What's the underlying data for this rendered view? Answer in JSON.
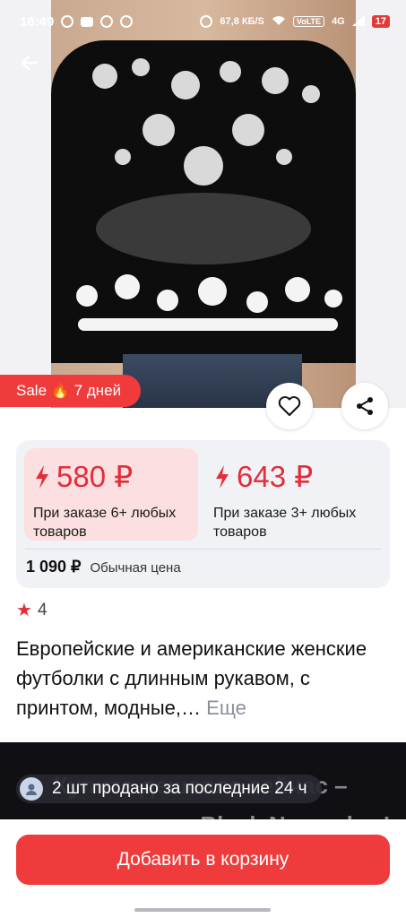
{
  "statusbar": {
    "time": "18:49",
    "speed": "67,8 КБ/S",
    "volte": "VoLTE",
    "net": "4G",
    "battery": "17"
  },
  "sale_badge": {
    "text": "Sale 🔥 7 дней"
  },
  "prices": {
    "option1": {
      "price": "580 ₽",
      "condition": "При заказе 6+ любых товаров"
    },
    "option2": {
      "price": "643 ₽",
      "condition": "При заказе 3+ любых товаров"
    },
    "regular": {
      "amount": "1 090 ₽",
      "label": "Обычная цена"
    }
  },
  "rating": {
    "value": "4"
  },
  "product": {
    "title": "Европейские и американские женские футболки с длинным рукавом, с принтом, модные,…",
    "more": "Еще"
  },
  "promo": {
    "line1": "Купите дешевле сейчас –",
    "line2": "распродажа Black November!"
  },
  "sold": {
    "text": "2 шт продано за последние 24 ч"
  },
  "cart": {
    "label": "Добавить в корзину"
  },
  "colors": {
    "accent": "#ef3b3b",
    "price": "#e32d3a"
  }
}
